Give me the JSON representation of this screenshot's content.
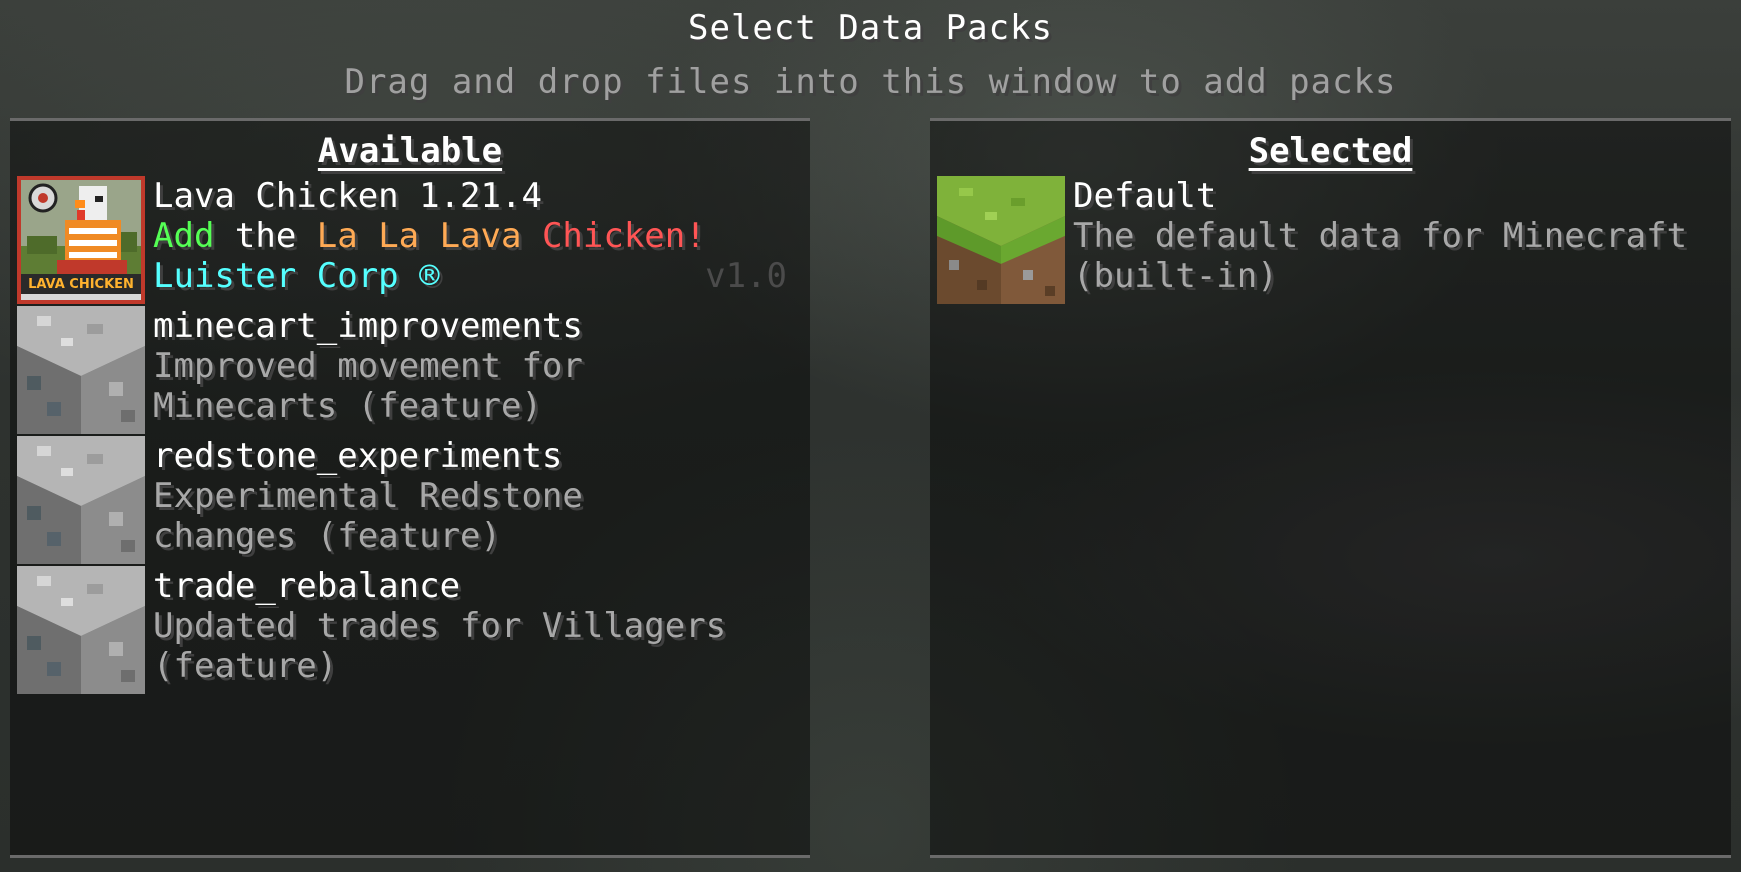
{
  "header": {
    "title": "Select Data Packs",
    "subtitle": "Drag and drop files into this window to add packs"
  },
  "available": {
    "title": "Available",
    "packs": [
      {
        "name": "Lava Chicken 1.21.4",
        "desc_parts": [
          {
            "text": "Add",
            "color": "#55ff55"
          },
          {
            "text": " the ",
            "color": "#ffffff"
          },
          {
            "text": "La La Lava",
            "color": "#ffaa55"
          },
          {
            "text": " Chicken!",
            "color": "#ff5555"
          }
        ],
        "author": "Luister Corp ®",
        "version": "v1.0",
        "icon": "lava-chicken-pack-icon",
        "icon_text": "LAVA CHICKEN"
      },
      {
        "name": "minecart_improvements",
        "desc_line1": "Improved movement for",
        "desc_line2": "Minecarts (feature)",
        "icon": "stone-block-icon"
      },
      {
        "name": "redstone_experiments",
        "desc_line1": "Experimental Redstone",
        "desc_line2": "changes (feature)",
        "icon": "stone-block-icon"
      },
      {
        "name": "trade_rebalance",
        "desc_line1": "Updated trades for Villagers",
        "desc_line2": "(feature)",
        "icon": "stone-block-icon"
      }
    ]
  },
  "selected": {
    "title": "Selected",
    "packs": [
      {
        "name": "Default",
        "desc_line1": "The default data for Minecraft",
        "desc_line2": "(built-in)",
        "icon": "grass-block-icon"
      }
    ]
  },
  "colors": {
    "accent_green": "#55ff55",
    "accent_orange": "#ffaa55",
    "accent_red": "#ff5555",
    "accent_cyan": "#55ffff",
    "muted_text": "#a8a8a8"
  }
}
